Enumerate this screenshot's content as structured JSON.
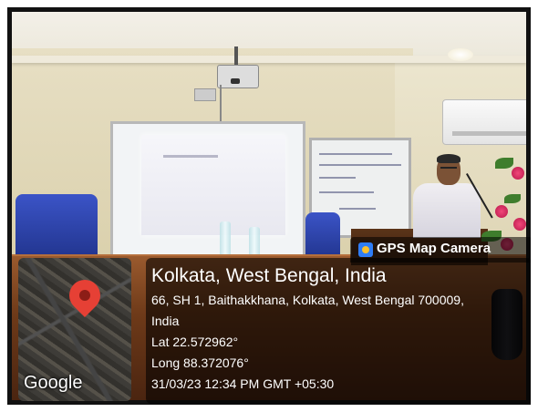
{
  "overlay": {
    "app_name": "GPS Map Camera",
    "icon": "camera-app-icon",
    "location_title": "Kolkata, West Bengal, India",
    "address_line_1": "66, SH 1, Baithakkhana, Kolkata, West Bengal 700009,",
    "address_line_2": "India",
    "latitude": "Lat 22.572962°",
    "longitude": "Long 88.372076°",
    "timestamp": "31/03/23 12:34 PM GMT +05:30",
    "map_label": "Google",
    "pin_icon": "map-pin-icon",
    "pin_color": "#e64035"
  }
}
